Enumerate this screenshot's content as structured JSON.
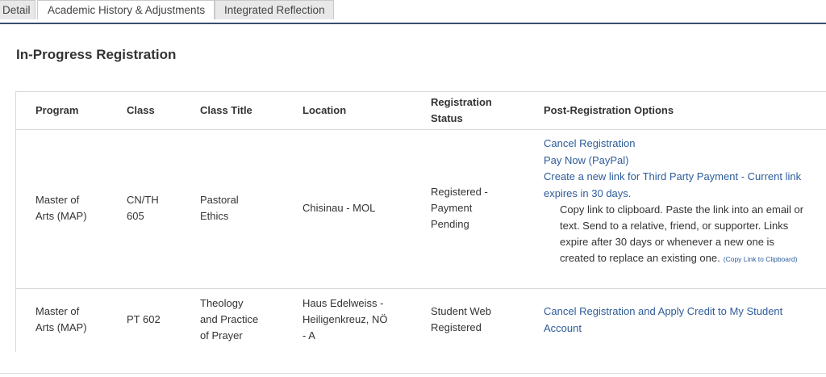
{
  "tabs": {
    "detail": "Detail",
    "history": "Academic History & Adjustments",
    "reflection": "Integrated Reflection"
  },
  "section_title": "In-Progress Registration",
  "table": {
    "headers": {
      "program": "Program",
      "class": "Class",
      "title": "Class Title",
      "location": "Location",
      "status_line1": "Registration",
      "status_line2": "Status",
      "options": "Post-Registration Options"
    },
    "rows": [
      {
        "program_l1": "Master of",
        "program_l2": "Arts (MAP)",
        "class_l1": "CN/TH",
        "class_l2": "605",
        "title_l1": "Pastoral",
        "title_l2": "Ethics",
        "location": "Chisinau - MOL",
        "status_l1": "Registered -",
        "status_l2": "Payment",
        "status_l3": "Pending",
        "cancel_link": "Cancel Registration",
        "pay_link": "Pay Now (PayPal)",
        "third_party_l1": "Create a new link for Third Party Payment - Current link",
        "third_party_l2": "expires in 30 days.",
        "note_l1": "Copy link to clipboard. Paste the link into an email or",
        "note_l2": "text. Send to a relative, friend, or supporter. Links",
        "note_l3": "expire after 30 days or whenever a new one is",
        "note_l4": "created to replace an existing one.",
        "copy_link": "(Copy Link to Clipboard)"
      },
      {
        "program_l1": "Master of",
        "program_l2": "Arts (MAP)",
        "class": "PT 602",
        "title_l1": "Theology",
        "title_l2": "and Practice",
        "title_l3": "of Prayer",
        "location_l1": "Haus Edelweiss -",
        "location_l2": "Heiligenkreuz, NÖ",
        "location_l3": "- A",
        "status_l1": "Student Web",
        "status_l2": "Registered",
        "cancel_credit_l1": "Cancel Registration and Apply Credit to My Student",
        "cancel_credit_l2": "Account"
      }
    ]
  }
}
